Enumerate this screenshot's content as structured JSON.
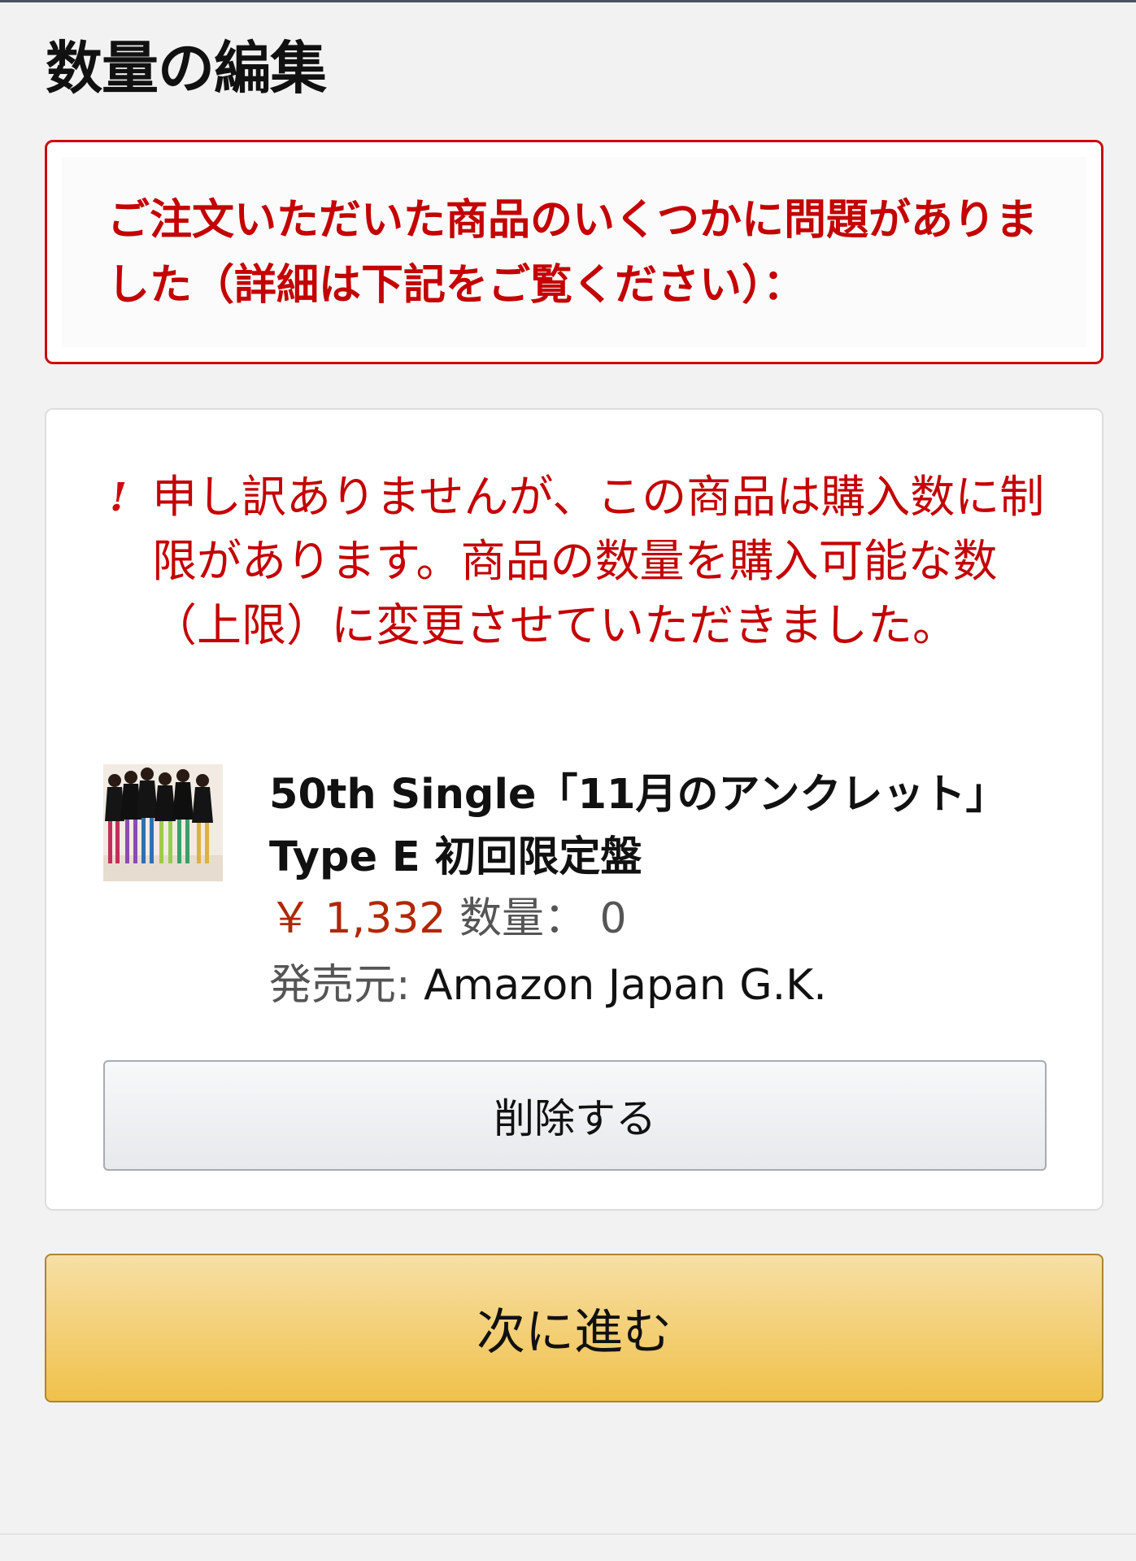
{
  "page": {
    "title": "数量の編集"
  },
  "alert": {
    "message": "ご注文いただいた商品のいくつかに問題がありました（詳細は下記をご覧ください）："
  },
  "item": {
    "warning_icon": "!",
    "warning_message": "申し訳ありませんが、この商品は購入数に制限があります。商品の数量を購入可能な数（上限）に変更させていただきました。",
    "thumbnail_icon": "album-cover-image",
    "title": "50th Single「11月のアンクレット」Type E 初回限定盤",
    "price": "￥ 1,332",
    "quantity_label": "数量：",
    "quantity_value": "0",
    "seller_label": "発売元:",
    "seller_name": "Amazon Japan G.K.",
    "delete_label": "削除する"
  },
  "footer": {
    "next_label": "次に進む"
  },
  "colors": {
    "alert_red": "#cc0c0c",
    "price_red": "#b12704",
    "primary_button_yellow": "#f0c14b",
    "background": "#f2f2f2"
  }
}
